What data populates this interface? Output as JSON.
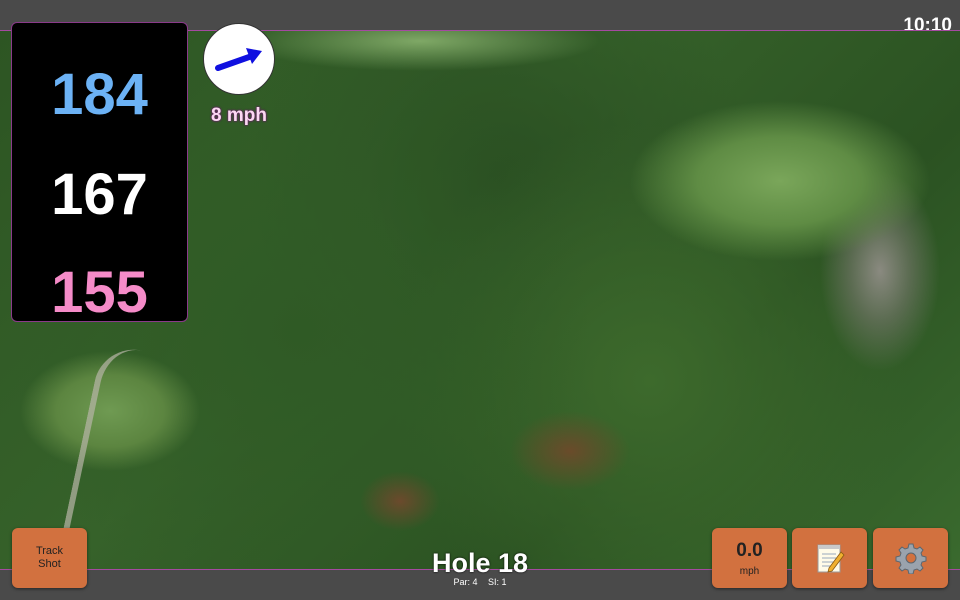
{
  "status": {
    "time": "10:10"
  },
  "distances": {
    "back": "184",
    "middle": "167",
    "front": "155"
  },
  "wind": {
    "speed_label": "8 mph"
  },
  "buttons": {
    "track_shot": "Track Shot",
    "speed_value": "0.0",
    "speed_unit": "mph"
  },
  "hole": {
    "title": "Hole 18",
    "par": "Par: 4",
    "si": "SI: 1"
  },
  "colors": {
    "back": "#6cb2f5",
    "middle": "#ffffff",
    "front": "#f58bc8",
    "button": "#d2713f",
    "wind_arrow": "#1010e0"
  },
  "icons": {
    "wind": "wind-direction-arrow-icon",
    "notes": "notepad-icon",
    "settings": "gear-icon"
  }
}
